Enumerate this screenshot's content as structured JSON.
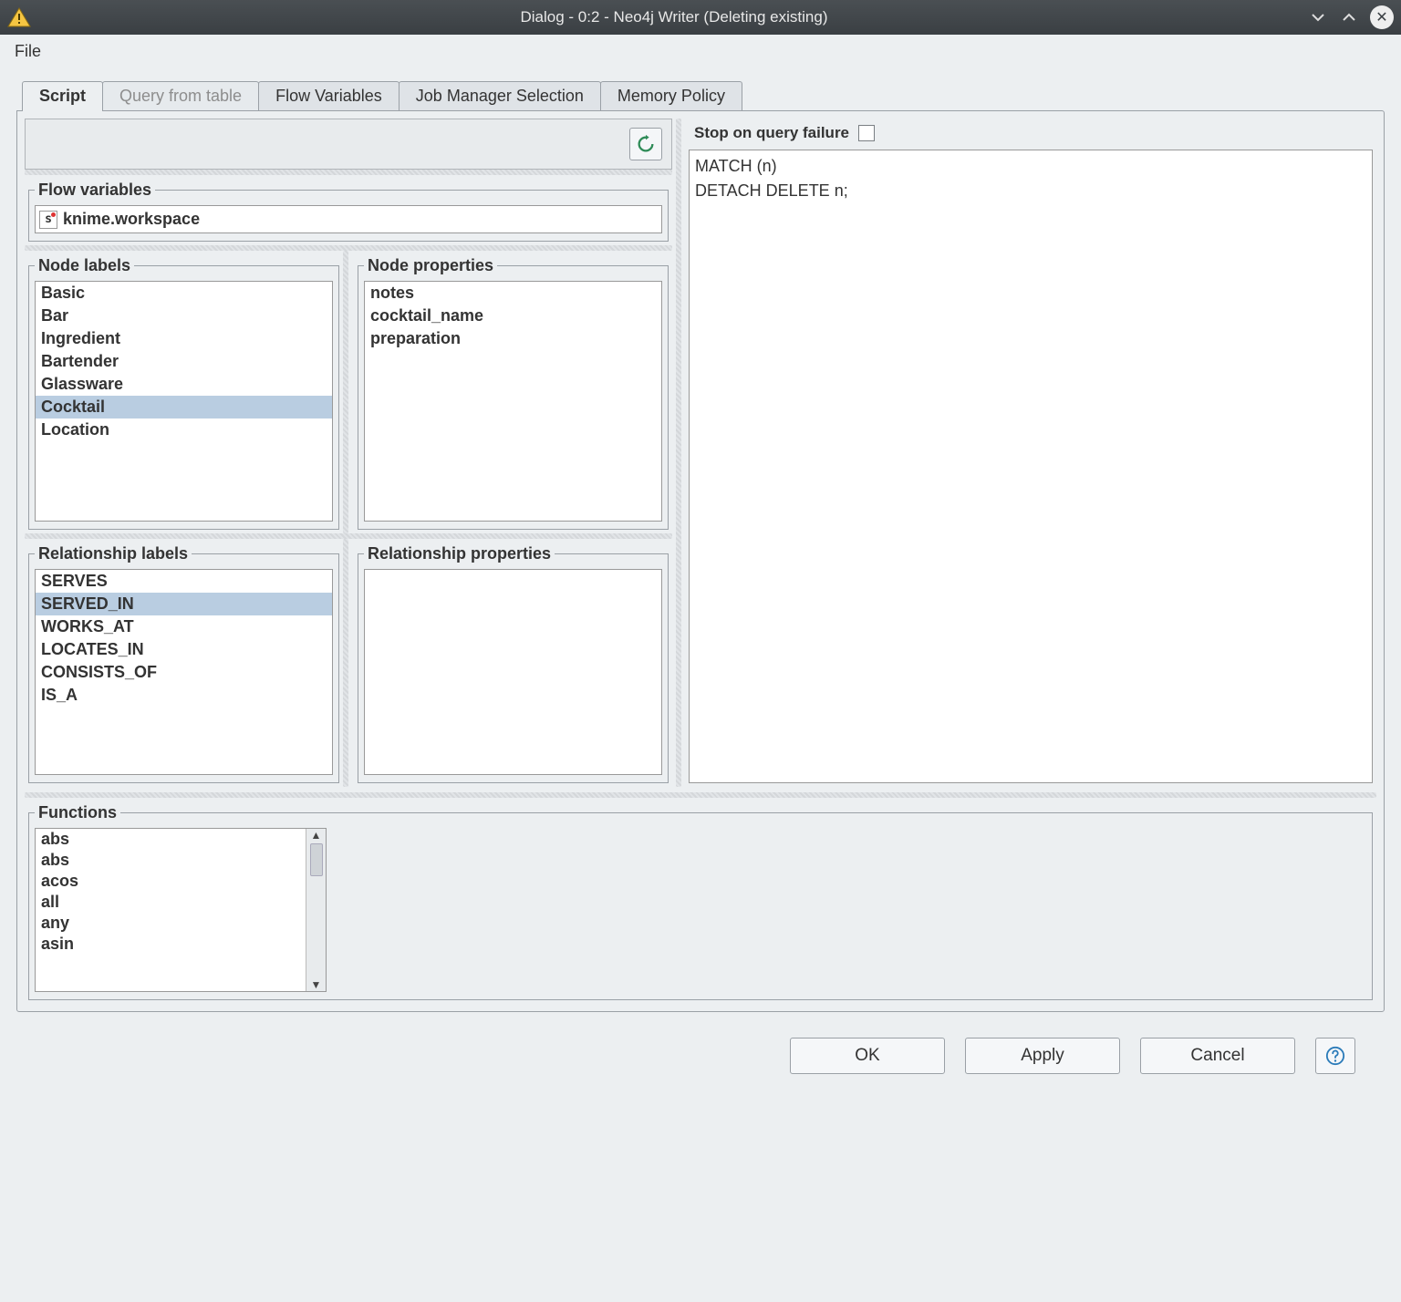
{
  "window": {
    "title": "Dialog - 0:2 - Neo4j Writer (Deleting existing)"
  },
  "menubar": {
    "file": "File"
  },
  "tabs": [
    {
      "label": "Script",
      "active": true
    },
    {
      "label": "Query from table",
      "disabled": true
    },
    {
      "label": "Flow Variables"
    },
    {
      "label": "Job Manager Selection"
    },
    {
      "label": "Memory Policy"
    }
  ],
  "panels": {
    "flow_variables": {
      "legend": "Flow variables",
      "icon_letter": "s",
      "value": "knime.workspace"
    },
    "node_labels": {
      "legend": "Node labels",
      "items": [
        "Basic",
        "Bar",
        "Ingredient",
        "Bartender",
        "Glassware",
        "Cocktail",
        "Location"
      ],
      "selected": "Cocktail"
    },
    "node_properties": {
      "legend": "Node properties",
      "items": [
        "notes",
        "cocktail_name",
        "preparation"
      ]
    },
    "relationship_labels": {
      "legend": "Relationship labels",
      "items": [
        "SERVES",
        "SERVED_IN",
        "WORKS_AT",
        "LOCATES_IN",
        "CONSISTS_OF",
        "IS_A"
      ],
      "selected": "SERVED_IN"
    },
    "relationship_properties": {
      "legend": "Relationship properties",
      "items": []
    },
    "functions": {
      "legend": "Functions",
      "items": [
        "abs",
        "abs",
        "acos",
        "all",
        "any",
        "asin"
      ]
    }
  },
  "right": {
    "stop_label": "Stop on query failure",
    "stop_checked": false,
    "query": "MATCH (n)\nDETACH DELETE n;"
  },
  "buttons": {
    "ok": "OK",
    "apply": "Apply",
    "cancel": "Cancel"
  }
}
